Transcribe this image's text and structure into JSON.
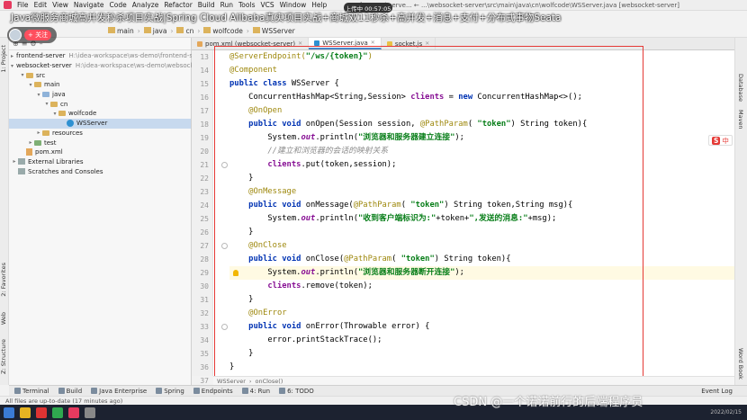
{
  "window": {
    "menu": [
      "File",
      "Edit",
      "View",
      "Navigate",
      "Code",
      "Analyze",
      "Refactor",
      "Build",
      "Run",
      "Tools",
      "VCS",
      "Window",
      "Help"
    ],
    "title": "frontend-serve... ← ...\\websocket-server\\src\\main\\java\\cn\\wolfcode\\WSServer.java [websocket-server]"
  },
  "video_overlay": {
    "title": "Java微服务商城高并发秒杀项目实战|Spring Cloud Alibaba真实项目实战+商城双11秒杀+高并发+消息+支付+分布式事物Seata",
    "follow_label": "+ 关注",
    "top_chip": "上传中 00:57:05",
    "watermark": "CSDN @一个诺诺前行的后端程序员"
  },
  "navbar": {
    "crumbs": [
      "main",
      "java",
      "cn",
      "wolfcode",
      "WSServer"
    ]
  },
  "left_tabs": [
    "1: Project",
    "2: Favorites",
    "Web",
    "Z: Structure"
  ],
  "project_tree": [
    {
      "indent": 0,
      "arrow": "▸",
      "icon": "folder",
      "label": "frontend-server",
      "path": "H:\\idea-workspace\\ws-demo\\frontend-serv"
    },
    {
      "indent": 0,
      "arrow": "▾",
      "icon": "folder",
      "label": "websocket-server",
      "path": "H:\\idea-workspace\\ws-demo\\websocket-server"
    },
    {
      "indent": 1,
      "arrow": "▾",
      "icon": "folder-yellow",
      "label": "src",
      "path": ""
    },
    {
      "indent": 2,
      "arrow": "▾",
      "icon": "folder-yellow",
      "label": "main",
      "path": ""
    },
    {
      "indent": 3,
      "arrow": "▾",
      "icon": "folder",
      "label": "java",
      "path": ""
    },
    {
      "indent": 4,
      "arrow": "▾",
      "icon": "folder-yellow",
      "label": "cn",
      "path": ""
    },
    {
      "indent": 5,
      "arrow": "▾",
      "icon": "folder-yellow",
      "label": "wolfcode",
      "path": ""
    },
    {
      "indent": 6,
      "arrow": "",
      "icon": "class",
      "label": "WSServer",
      "path": "",
      "selected": true
    },
    {
      "indent": 3,
      "arrow": "▸",
      "icon": "folder-yellow",
      "label": "resources",
      "path": ""
    },
    {
      "indent": 2,
      "arrow": "▸",
      "icon": "folder-green",
      "label": "test",
      "path": ""
    },
    {
      "indent": 1,
      "arrow": "",
      "icon": "file",
      "label": "pom.xml",
      "path": ""
    },
    {
      "indent": 0,
      "arrow": "▸",
      "icon": "lib",
      "label": "External Libraries",
      "path": ""
    },
    {
      "indent": 0,
      "arrow": "",
      "icon": "lib",
      "label": "Scratches and Consoles",
      "path": ""
    }
  ],
  "tabs": [
    {
      "label": "pom.xml (websocket-server)",
      "color": "#e3a75a",
      "active": false
    },
    {
      "label": "WSServer.java",
      "color": "#2e90d1",
      "active": true
    },
    {
      "label": "socket.js",
      "color": "#e8c146",
      "active": false
    }
  ],
  "line_numbers": [
    "13",
    "14",
    "15",
    "16",
    "17",
    "18",
    "19",
    "20",
    "21",
    "22",
    "23",
    "24",
    "25",
    "26",
    "27",
    "28",
    "29",
    "30",
    "31",
    "32",
    "33",
    "34",
    "35",
    "36",
    "37"
  ],
  "code_lines": [
    [
      [
        "a",
        "@ServerEndpoint("
      ],
      [
        "s",
        "\"/ws/{token}\""
      ],
      [
        "a",
        ")"
      ]
    ],
    [
      [
        "a",
        "@Component"
      ]
    ],
    [
      [
        "k",
        "public class "
      ],
      [
        "",
        "WSServer {"
      ]
    ],
    [
      [
        "",
        "    ConcurrentHashMap<String,Session> "
      ],
      [
        "f",
        "clients"
      ],
      [
        "",
        " = "
      ],
      [
        "k",
        "new "
      ],
      [
        "",
        "ConcurrentHashMap<>();"
      ]
    ],
    [
      [
        "a",
        "    @OnOpen"
      ]
    ],
    [
      [
        "k",
        "    public void "
      ],
      [
        "",
        "onOpen(Session session, "
      ],
      [
        "a",
        "@PathParam"
      ],
      [
        "",
        "( "
      ],
      [
        "s",
        "\"token\""
      ],
      [
        "",
        ") String token){"
      ]
    ],
    [
      [
        "",
        "        System."
      ],
      [
        "st",
        "out"
      ],
      [
        "",
        ".println("
      ],
      [
        "s",
        "\"浏览器和服务器建立连接\""
      ],
      [
        "",
        ");"
      ]
    ],
    [
      [
        "c",
        "        //建立和浏览器的会话的映射关系"
      ]
    ],
    [
      [
        "f",
        "        clients"
      ],
      [
        "",
        ".put(token,session);"
      ]
    ],
    [
      [
        "",
        "    }"
      ]
    ],
    [
      [
        "a",
        "    @OnMessage"
      ]
    ],
    [
      [
        "k",
        "    public void "
      ],
      [
        "",
        "onMessage("
      ],
      [
        "a",
        "@PathParam"
      ],
      [
        "",
        "( "
      ],
      [
        "s",
        "\"token\""
      ],
      [
        "",
        ") String token,String msg){"
      ]
    ],
    [
      [
        "",
        "        System."
      ],
      [
        "st",
        "out"
      ],
      [
        "",
        ".println("
      ],
      [
        "s",
        "\"收到客户端标识为:\""
      ],
      [
        "",
        "+token+"
      ],
      [
        "s",
        "\",发送的消息:\""
      ],
      [
        "",
        "+msg);"
      ]
    ],
    [
      [
        "",
        "    }"
      ]
    ],
    [
      [
        "a",
        "    @OnClose"
      ]
    ],
    [
      [
        "k",
        "    public void "
      ],
      [
        "",
        "onClose("
      ],
      [
        "a",
        "@PathParam"
      ],
      [
        "",
        "( "
      ],
      [
        "s",
        "\"token\""
      ],
      [
        "",
        ") String token){"
      ]
    ],
    [
      [
        "",
        "        System."
      ],
      [
        "st",
        "out"
      ],
      [
        "",
        ".println("
      ],
      [
        "s",
        "\"浏览器和服务器断开连接\""
      ],
      [
        "",
        ");"
      ]
    ],
    [
      [
        "f",
        "        clients"
      ],
      [
        "",
        ".remove(token);"
      ]
    ],
    [
      [
        "",
        "    }"
      ]
    ],
    [
      [
        "a",
        "    @OnError"
      ]
    ],
    [
      [
        "k",
        "    public void "
      ],
      [
        "",
        "onError(Throwable error) {"
      ]
    ],
    [
      [
        "",
        "        error.printStackTrace();"
      ]
    ],
    [
      [
        "",
        "    }"
      ]
    ],
    [
      [
        "",
        "}"
      ]
    ],
    [
      [
        "",
        ""
      ]
    ]
  ],
  "editor_breadcrumb": [
    "WSServer",
    "onClose()"
  ],
  "right_tabs": [
    "Database",
    "Maven",
    "Word Book"
  ],
  "ime": {
    "badge": "S",
    "text": "中"
  },
  "tool_windows": [
    "Terminal",
    "Build",
    "Java Enterprise",
    "Spring",
    "Endpoints",
    "4: Run",
    "6: TODO"
  ],
  "event_log": "Event Log",
  "status": "All files are up-to-date (17 minutes ago)",
  "clock": {
    "time": "2022/02/15"
  }
}
